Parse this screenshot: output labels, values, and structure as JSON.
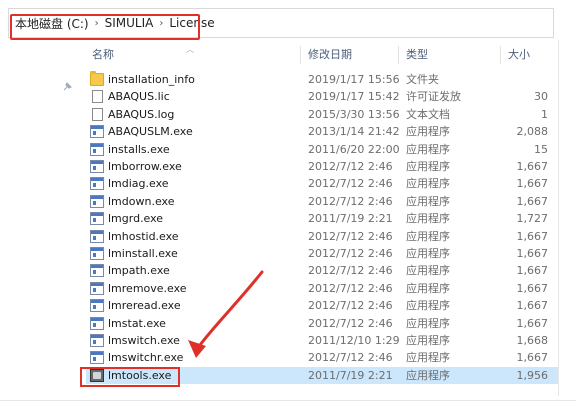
{
  "breadcrumb": {
    "items": [
      "本地磁盘 (C:)",
      "SIMULIA",
      "License"
    ],
    "separator": "›"
  },
  "columns": {
    "name": "名称",
    "date": "修改日期",
    "type": "类型",
    "size": "大小"
  },
  "files": [
    {
      "name": "installation_info",
      "date": "2019/1/17 15:56",
      "type": "文件夹",
      "size": "",
      "icon": "folder-icon"
    },
    {
      "name": "ABAQUS.lic",
      "date": "2019/1/17 15:42",
      "type": "许可证发放",
      "size": "30",
      "icon": "document-icon"
    },
    {
      "name": "ABAQUS.log",
      "date": "2015/3/30 13:56",
      "type": "文本文档",
      "size": "1",
      "icon": "document-icon"
    },
    {
      "name": "ABAQUSLM.exe",
      "date": "2013/1/14 21:42",
      "type": "应用程序",
      "size": "2,088",
      "icon": "exe-icon"
    },
    {
      "name": "installs.exe",
      "date": "2011/6/20 22:00",
      "type": "应用程序",
      "size": "15",
      "icon": "exe-icon"
    },
    {
      "name": "lmborrow.exe",
      "date": "2012/7/12 2:46",
      "type": "应用程序",
      "size": "1,667",
      "icon": "exe-icon"
    },
    {
      "name": "lmdiag.exe",
      "date": "2012/7/12 2:46",
      "type": "应用程序",
      "size": "1,667",
      "icon": "exe-icon"
    },
    {
      "name": "lmdown.exe",
      "date": "2012/7/12 2:46",
      "type": "应用程序",
      "size": "1,667",
      "icon": "exe-icon"
    },
    {
      "name": "lmgrd.exe",
      "date": "2011/7/19 2:21",
      "type": "应用程序",
      "size": "1,727",
      "icon": "exe-icon"
    },
    {
      "name": "lmhostid.exe",
      "date": "2012/7/12 2:46",
      "type": "应用程序",
      "size": "1,667",
      "icon": "exe-icon"
    },
    {
      "name": "lminstall.exe",
      "date": "2012/7/12 2:46",
      "type": "应用程序",
      "size": "1,667",
      "icon": "exe-icon"
    },
    {
      "name": "lmpath.exe",
      "date": "2012/7/12 2:46",
      "type": "应用程序",
      "size": "1,667",
      "icon": "exe-icon"
    },
    {
      "name": "lmremove.exe",
      "date": "2012/7/12 2:46",
      "type": "应用程序",
      "size": "1,667",
      "icon": "exe-icon"
    },
    {
      "name": "lmreread.exe",
      "date": "2012/7/12 2:46",
      "type": "应用程序",
      "size": "1,667",
      "icon": "exe-icon"
    },
    {
      "name": "lmstat.exe",
      "date": "2012/7/12 2:46",
      "type": "应用程序",
      "size": "1,667",
      "icon": "exe-icon"
    },
    {
      "name": "lmswitch.exe",
      "date": "2011/12/10 1:29",
      "type": "应用程序",
      "size": "1,668",
      "icon": "exe-icon"
    },
    {
      "name": "lmswitchr.exe",
      "date": "2012/7/12 2:46",
      "type": "应用程序",
      "size": "1,667",
      "icon": "exe-icon"
    },
    {
      "name": "lmtools.exe",
      "date": "2011/7/19 2:21",
      "type": "应用程序",
      "size": "1,956",
      "icon": "lmtools-icon",
      "selected": true
    }
  ],
  "colors": {
    "highlight": "#e0302a",
    "selected_row": "#cce6fb",
    "header_text": "#4c607a"
  }
}
